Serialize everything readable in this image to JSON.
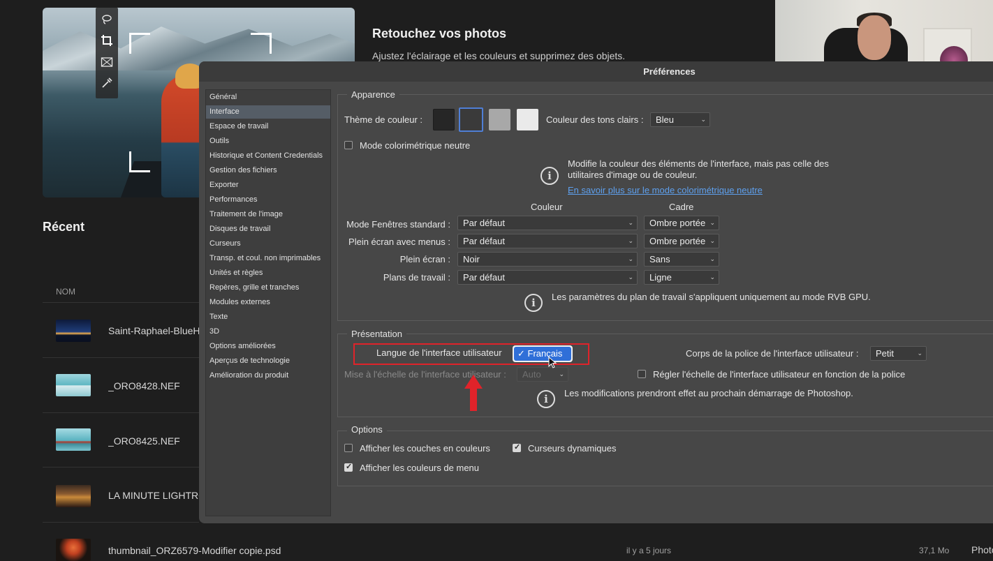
{
  "home": {
    "promo_title": "Retouchez vos photos",
    "promo_subtitle": "Ajustez l'éclairage et les couleurs et supprimez des objets.",
    "recent_title": "Récent",
    "column_name": "NOM",
    "files": [
      {
        "name": "Saint-Raphael-BlueHo"
      },
      {
        "name": "_ORO8428.NEF"
      },
      {
        "name": "_ORO8425.NEF"
      },
      {
        "name": "LA MINUTE LIGHTRO"
      },
      {
        "name": "thumbnail_ORZ6579-Modifier copie.psd",
        "date": "il y a 5 jours",
        "size": "37,1 Mo",
        "type": "Photo"
      }
    ],
    "tool_icons": [
      "lasso-icon",
      "crop-icon",
      "frame-icon",
      "eyedropper-icon"
    ]
  },
  "dialog": {
    "title": "Préférences",
    "categories": [
      "Général",
      "Interface",
      "Espace de travail",
      "Outils",
      "Historique et Content Credentials",
      "Gestion des fichiers",
      "Exporter",
      "Performances",
      "Traitement de l'image",
      "Disques de travail",
      "Curseurs",
      "Transp. et coul. non imprimables",
      "Unités et règles",
      "Repères, grille et tranches",
      "Modules externes",
      "Texte",
      "3D",
      "Options améliorées",
      "Aperçus de technologie",
      "Amélioration du produit"
    ],
    "selected_category": "Interface",
    "appearance": {
      "title": "Apparence",
      "theme_label": "Thème de couleur :",
      "theme_colors": [
        "#262626",
        "#3a3a3a",
        "#a8a8a8",
        "#eaeaea"
      ],
      "highlight_label": "Couleur des tons clairs :",
      "highlight_value": "Bleu",
      "neutral_mode_label": "Mode colorimétrique neutre",
      "info_text_1": "Modifie la couleur des éléments de l'interface, mais pas celle des",
      "info_text_2": "utilitaires d'image ou de couleur.",
      "info_link": "En savoir plus sur le mode colorimétrique neutre",
      "col_color": "Couleur",
      "col_border": "Cadre",
      "rows": [
        {
          "label": "Mode Fenêtres standard :",
          "color": "Par défaut",
          "border": "Ombre portée"
        },
        {
          "label": "Plein écran avec menus :",
          "color": "Par défaut",
          "border": "Ombre portée"
        },
        {
          "label": "Plein écran :",
          "color": "Noir",
          "border": "Sans"
        },
        {
          "label": "Plans de travail :",
          "color": "Par défaut",
          "border": "Ligne"
        }
      ],
      "artboard_note": "Les paramètres du plan de travail s'appliquent uniquement au mode RVB GPU."
    },
    "presentation": {
      "title": "Présentation",
      "language_label": "Langue de l'interface utilisateur",
      "language_value": "✓ Français",
      "font_size_label": "Corps de la police de l'interface utilisateur :",
      "font_size_value": "Petit",
      "scale_label": "Mise à l'échelle de l'interface utilisateur :",
      "scale_value": "Auto",
      "scale_with_font_label": "Régler l'échelle de l'interface utilisateur en fonction de la police",
      "restart_note": "Les modifications prendront effet au prochain démarrage de Photoshop."
    },
    "options": {
      "title": "Options",
      "colored_channels": {
        "label": "Afficher les couches en couleurs",
        "checked": false
      },
      "dynamic_sliders": {
        "label": "Curseurs dynamiques",
        "checked": true
      },
      "menu_colors": {
        "label": "Afficher les couleurs de menu",
        "checked": true
      }
    }
  },
  "colors": {
    "highlight_red": "#e0232a",
    "selection_blue": "#2f6fd8",
    "link_blue": "#5ea0ee"
  }
}
